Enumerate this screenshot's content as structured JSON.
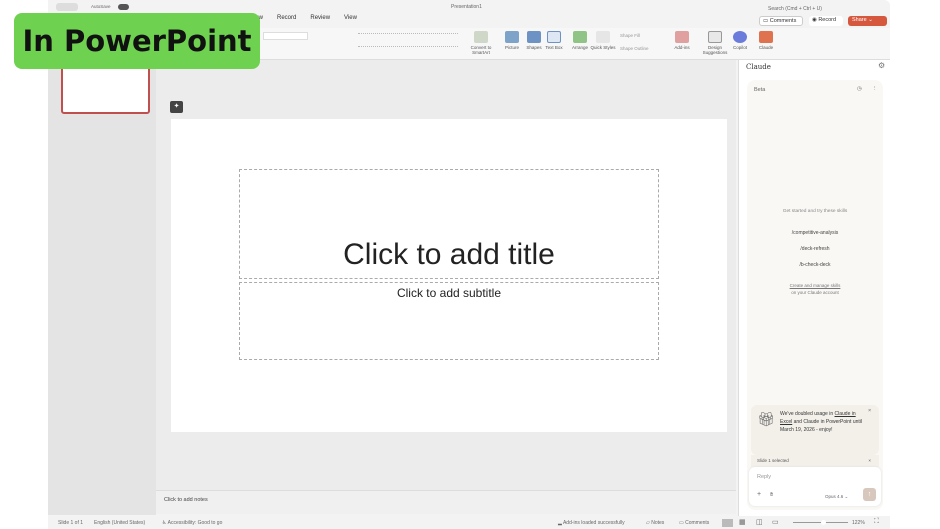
{
  "overlay_label": "In PowerPoint",
  "titlebar": {
    "autosave": "AutoSave",
    "doc_title": "Presentation1",
    "search": "Search (Cmd + Ctrl + U)"
  },
  "tabs": [
    "Show",
    "Record",
    "Review",
    "View"
  ],
  "actions": {
    "comments": "Comments",
    "record": "Record",
    "share": "Share"
  },
  "ribbon": [
    {
      "label": "Convert to SmartArt",
      "color": "#cfd8c8"
    },
    {
      "label": "Picture",
      "color": "#7da3c9"
    },
    {
      "label": "Shapes",
      "color": "#6d93c4"
    },
    {
      "label": "Text Box",
      "color": "#dde8f4"
    },
    {
      "label": "Arrange",
      "color": "#8fc486"
    },
    {
      "label": "Quick Styles",
      "color": "#e6e6e6"
    },
    {
      "label": "Add-ins",
      "color": "#e0a0a0"
    },
    {
      "label": "Design Suggestions",
      "color": "#e8e8e8"
    },
    {
      "label": "Copilot",
      "color": "#6a7bdc"
    },
    {
      "label": "Claude",
      "color": "#e0734f"
    }
  ],
  "ribbon_small": {
    "shape_fill": "Shape Fill",
    "shape_outline": "Shape Outline"
  },
  "slide": {
    "title": "Click to add title",
    "subtitle": "Click to add subtitle"
  },
  "notes": "Click to add notes",
  "status": {
    "slide": "Slide 1 of 1",
    "language": "English (United States)",
    "accessibility": "Accessibility: Good to go",
    "addins": "Add-ins loaded successfully",
    "notes": "Notes",
    "comments": "Comments",
    "zoom": "122%"
  },
  "claude": {
    "title": "Claude",
    "badge": "Beta",
    "prompt": "Get started and try these skills",
    "skills": [
      "/competitive-analysis",
      "/deck-refresh",
      "/b-check-deck"
    ],
    "manage_link": "Create and manage skills",
    "manage_sub": "on your Claude account",
    "promo_pre": "We've doubled usage in ",
    "promo_link": "Claude in Excel",
    "promo_post": " and Claude in PowerPoint until March 19, 2026 - enjoy!",
    "selection": "Slide 1 selected",
    "reply_placeholder": "Reply",
    "model": "Opus 4.6"
  }
}
